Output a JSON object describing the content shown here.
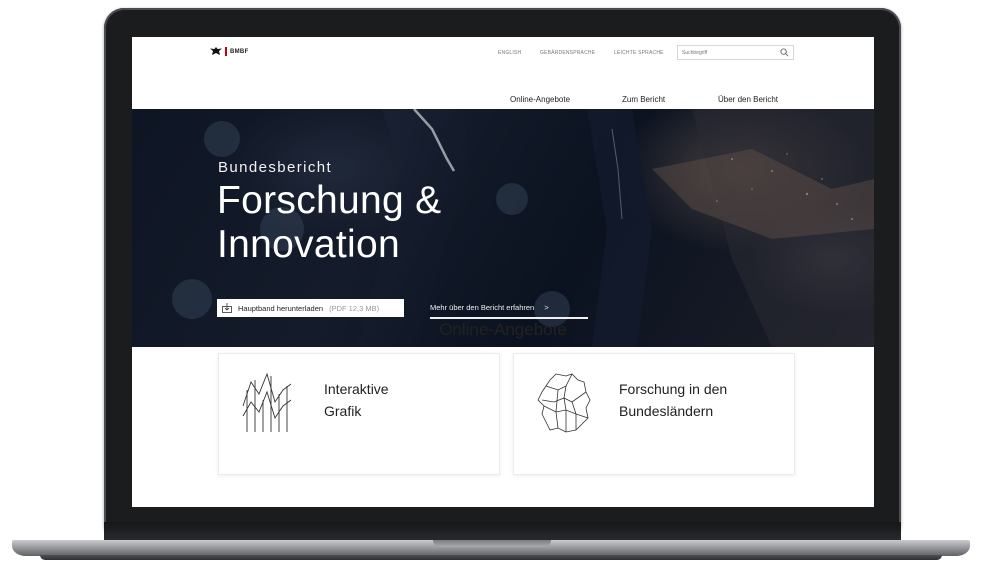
{
  "brand": {
    "logo_text": "BMBF"
  },
  "header": {
    "util_links": [
      "ENGLISH",
      "GEBÄRDENSPRACHE",
      "LEICHTE SPRACHE"
    ],
    "search": {
      "placeholder": "Suchbegriff"
    },
    "nav": [
      "Online-Angebote",
      "Zum Bericht",
      "Über den Bericht"
    ]
  },
  "hero": {
    "kicker": "Bundesbericht",
    "title_line1": "Forschung &",
    "title_line2": "Innovation",
    "download_label": "Hauptband herunterladen",
    "download_meta": "(PDF 12,3 MB)",
    "more_label": "Mehr über den Bericht erfahren",
    "more_arrow": ">"
  },
  "section": {
    "title": "Online-Angebote",
    "cards": [
      {
        "line1": "Interaktive",
        "line2": "Grafik",
        "icon": "line-chart-icon"
      },
      {
        "line1": "Forschung in den",
        "line2": "Bundesländern",
        "icon": "germany-map-icon"
      }
    ]
  },
  "colors": {
    "hero_bg": "#0e1524",
    "accent_red": "#cc0000",
    "text": "#222222"
  }
}
